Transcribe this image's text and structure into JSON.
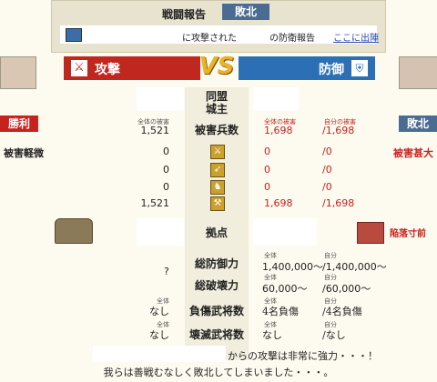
{
  "header": {
    "title": "戦闘報告",
    "result_badge": "敗北",
    "report_text_1": "に攻撃された",
    "report_text_2": "の防衛報告",
    "link_text": "ここに出陣"
  },
  "banner": {
    "attack_label": "攻撃",
    "vs_label": "VS",
    "defense_label": "防御"
  },
  "rows": {
    "alliance_label": "同盟",
    "lord_label": "城主",
    "damage_label": "被害兵数",
    "base_label": "拠点",
    "total_def_label": "総防御力",
    "total_break_label": "総破壊力",
    "injured_label": "負傷武将数",
    "dead_label": "壊滅武将数"
  },
  "attacker": {
    "result": "勝利",
    "total_damage_header": "全体の被害",
    "total_damage": "1,521",
    "status": "被害軽微",
    "unit_losses": [
      "0",
      "0",
      "0",
      "1,521"
    ],
    "total_def": "?",
    "injured_header": "全体",
    "injured": "なし",
    "dead_header": "全体",
    "dead": "なし"
  },
  "defender": {
    "result": "敗北",
    "total_damage_header": "全体の被害",
    "own_damage_header": "自分の被害",
    "total_damage": "1,698",
    "own_damage": "/1,698",
    "status": "被害甚大",
    "unit_losses_total": [
      "0",
      "0",
      "0",
      "1,698"
    ],
    "unit_losses_own": [
      "/0",
      "/0",
      "/0",
      "/1,698"
    ],
    "base_status": "陥落寸前",
    "def_total_header": "全体",
    "def_own_header": "自分",
    "def_total": "1,400,000～",
    "def_own": "/1,400,000～",
    "break_total_header": "全体",
    "break_own_header": "自分",
    "break_total": "60,000～",
    "break_own": "/60,000～",
    "injured_total_header": "全体",
    "injured_own_header": "自分",
    "injured_total": "4名負傷",
    "injured_own": "/4名負傷",
    "dead_total_header": "全体",
    "dead_own_header": "自分",
    "dead_total": "なし",
    "dead_own": "/なし"
  },
  "footer": {
    "line1": "からの攻撃は非常に強力・・・！",
    "line2": "我らは善戦むなしく敗北してしまいました・・・。"
  },
  "colors": {
    "attack_red": "#c0281f",
    "defense_blue": "#2c6fb4",
    "win_red": "#c6231f",
    "lose_blue": "#4a6c93",
    "vs_gold": "#e9b227"
  }
}
